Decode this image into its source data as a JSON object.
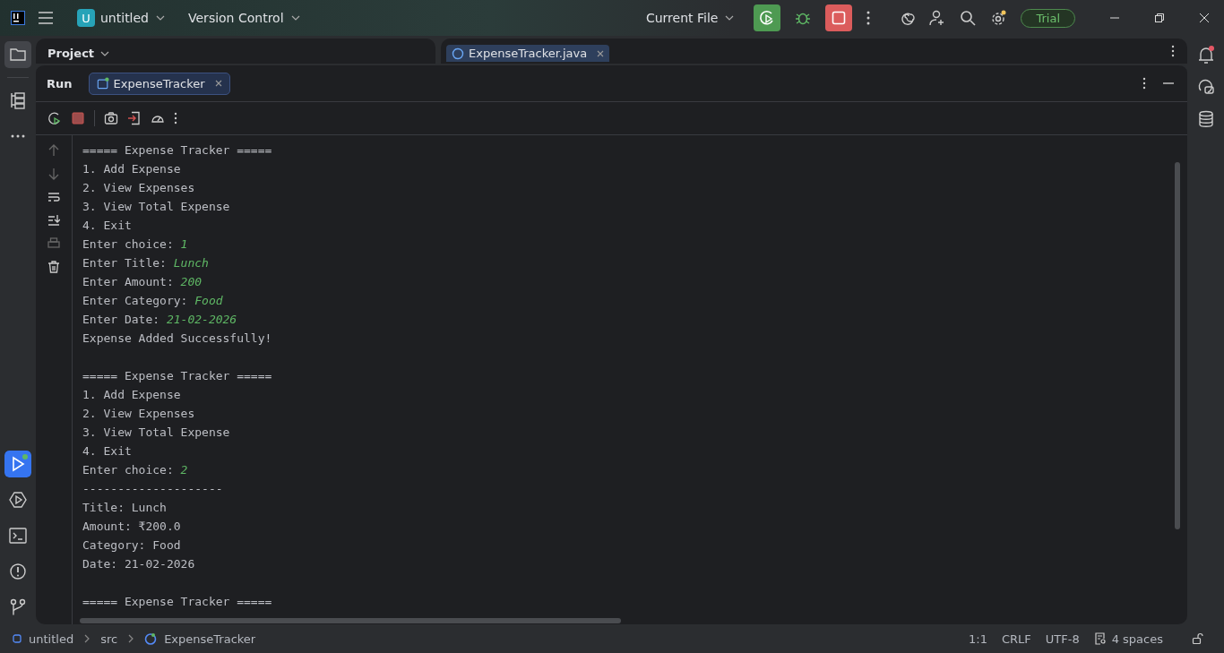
{
  "title_bar": {
    "project_badge": "U",
    "project": "untitled",
    "vcs": "Version Control",
    "run_config": "Current File",
    "trial": "Trial",
    "settings_has_update": true
  },
  "project_panel": {
    "title": "Project"
  },
  "editor_tabs": [
    {
      "label": "ExpenseTracker.java",
      "selected": true
    }
  ],
  "run_panel": {
    "title": "Run",
    "tabs": [
      {
        "label": "ExpenseTracker",
        "selected": true
      }
    ]
  },
  "console": [
    {
      "kind": "output",
      "text": "===== Expense Tracker ====="
    },
    {
      "kind": "output",
      "text": "1. Add Expense"
    },
    {
      "kind": "output",
      "text": "2. View Expenses"
    },
    {
      "kind": "output",
      "text": "3. View Total Expense"
    },
    {
      "kind": "output",
      "text": "4. Exit"
    },
    {
      "kind": "prompt",
      "text": "Enter choice: ",
      "input": "1"
    },
    {
      "kind": "prompt",
      "text": "Enter Title: ",
      "input": "Lunch"
    },
    {
      "kind": "prompt",
      "text": "Enter Amount: ",
      "input": "200"
    },
    {
      "kind": "prompt",
      "text": "Enter Category: ",
      "input": "Food"
    },
    {
      "kind": "prompt",
      "text": "Enter Date: ",
      "input": "21-02-2026"
    },
    {
      "kind": "output",
      "text": "Expense Added Successfully!"
    },
    {
      "kind": "blank"
    },
    {
      "kind": "output",
      "text": "===== Expense Tracker ====="
    },
    {
      "kind": "output",
      "text": "1. Add Expense"
    },
    {
      "kind": "output",
      "text": "2. View Expenses"
    },
    {
      "kind": "output",
      "text": "3. View Total Expense"
    },
    {
      "kind": "output",
      "text": "4. Exit"
    },
    {
      "kind": "prompt",
      "text": "Enter choice: ",
      "input": "2"
    },
    {
      "kind": "output",
      "text": "--------------------"
    },
    {
      "kind": "output",
      "text": "Title: Lunch"
    },
    {
      "kind": "output",
      "text": "Amount: ₹200.0"
    },
    {
      "kind": "output",
      "text": "Category: Food"
    },
    {
      "kind": "output",
      "text": "Date: 21-02-2026"
    },
    {
      "kind": "blank"
    },
    {
      "kind": "output",
      "text": "===== Expense Tracker ====="
    }
  ],
  "status_bar": {
    "breadcrumbs": [
      "untitled",
      "src",
      "ExpenseTracker"
    ],
    "position": "1:1",
    "line_ending": "CRLF",
    "encoding": "UTF-8",
    "indent": "4 spaces"
  }
}
